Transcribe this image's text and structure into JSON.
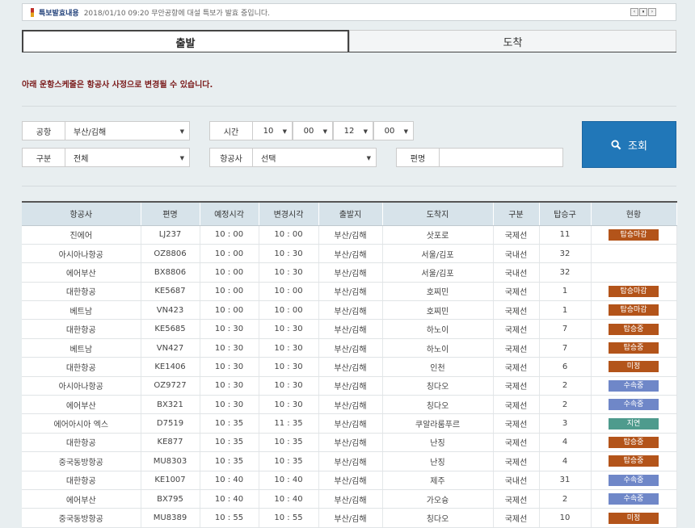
{
  "notice": {
    "label": "특보발효내용",
    "text": "2018/01/10 09:20 무안공항에 대설 특보가 발효 중입니다.",
    "controls": [
      "‹",
      "⏸",
      "›"
    ]
  },
  "tabs": {
    "departure": "출발",
    "arrival": "도착"
  },
  "warning": "아래 운항스케줄은 항공사 사정으로 변경될 수 있습니다.",
  "filters": {
    "airport_label": "공항",
    "airport_value": "부산/김해",
    "time_label": "시간",
    "time_hour1": "10",
    "time_min1": "00",
    "time_hour2": "12",
    "time_min2": "00",
    "type_label": "구분",
    "type_value": "전체",
    "airline_label": "항공사",
    "airline_value": "선택",
    "flight_label": "편명",
    "flight_value": ""
  },
  "search_label": "조회",
  "status_colors": {
    "탑승마감": "#b3541a",
    "탑승중": "#b3541a",
    "미정": "#b3541a",
    "수속중": "#6f87c8",
    "지연": "#4e9b8d"
  },
  "table": {
    "headers": [
      "항공사",
      "편명",
      "예정시각",
      "변경시각",
      "출발지",
      "도착지",
      "구분",
      "탑승구",
      "현황"
    ],
    "rows": [
      [
        "진에어",
        "LJ237",
        "10 : 00",
        "10 : 00",
        "부산/김해",
        "삿포로",
        "국제선",
        "11",
        "탑승마감"
      ],
      [
        "아시아나항공",
        "OZ8806",
        "10 : 00",
        "10 : 30",
        "부산/김해",
        "서울/김포",
        "국내선",
        "32",
        ""
      ],
      [
        "에어부산",
        "BX8806",
        "10 : 00",
        "10 : 30",
        "부산/김해",
        "서울/김포",
        "국내선",
        "32",
        ""
      ],
      [
        "대한항공",
        "KE5687",
        "10 : 00",
        "10 : 00",
        "부산/김해",
        "호찌민",
        "국제선",
        "1",
        "탑승마감"
      ],
      [
        "베트남",
        "VN423",
        "10 : 00",
        "10 : 00",
        "부산/김해",
        "호찌민",
        "국제선",
        "1",
        "탑승마감"
      ],
      [
        "대한항공",
        "KE5685",
        "10 : 30",
        "10 : 30",
        "부산/김해",
        "하노이",
        "국제선",
        "7",
        "탑승중"
      ],
      [
        "베트남",
        "VN427",
        "10 : 30",
        "10 : 30",
        "부산/김해",
        "하노이",
        "국제선",
        "7",
        "탑승중"
      ],
      [
        "대한항공",
        "KE1406",
        "10 : 30",
        "10 : 30",
        "부산/김해",
        "인천",
        "국제선",
        "6",
        "미정"
      ],
      [
        "아시아나항공",
        "OZ9727",
        "10 : 30",
        "10 : 30",
        "부산/김해",
        "칭다오",
        "국제선",
        "2",
        "수속중"
      ],
      [
        "에어부산",
        "BX321",
        "10 : 30",
        "10 : 30",
        "부산/김해",
        "칭다오",
        "국제선",
        "2",
        "수속중"
      ],
      [
        "에어아시아 엑스",
        "D7519",
        "10 : 35",
        "11 : 35",
        "부산/김해",
        "쿠알라룸푸르",
        "국제선",
        "3",
        "지연"
      ],
      [
        "대한항공",
        "KE877",
        "10 : 35",
        "10 : 35",
        "부산/김해",
        "난징",
        "국제선",
        "4",
        "탑승중"
      ],
      [
        "중국동방항공",
        "MU8303",
        "10 : 35",
        "10 : 35",
        "부산/김해",
        "난징",
        "국제선",
        "4",
        "탑승중"
      ],
      [
        "대한항공",
        "KE1007",
        "10 : 40",
        "10 : 40",
        "부산/김해",
        "제주",
        "국내선",
        "31",
        "수속중"
      ],
      [
        "에어부산",
        "BX795",
        "10 : 40",
        "10 : 40",
        "부산/김해",
        "가오슝",
        "국제선",
        "2",
        "수속중"
      ],
      [
        "중국동방항공",
        "MU8389",
        "10 : 55",
        "10 : 55",
        "부산/김해",
        "칭다오",
        "국제선",
        "10",
        "미정"
      ]
    ]
  }
}
